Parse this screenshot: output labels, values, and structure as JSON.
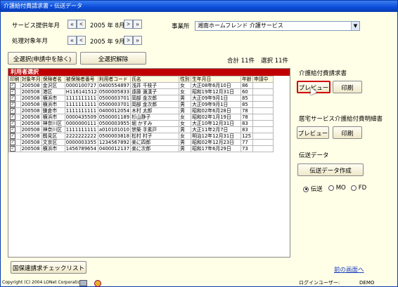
{
  "window": {
    "title": "介護給付費請求書・伝送データ"
  },
  "service_month": {
    "label": "サービス提供年月",
    "first": "«",
    "prev": "<",
    "value": "2005 年 8月",
    "next": ">",
    "last": "»"
  },
  "process_month": {
    "label": "処理対象年月",
    "first": "«",
    "prev": "<",
    "value": "2005 年 9月",
    "next": ">",
    "last": "»"
  },
  "office": {
    "label": "事業所",
    "value": "湘南ホームフレンド  介護サービス"
  },
  "select_all_label": "全選択(申請中を除く)",
  "deselect_all_label": "全選択解除",
  "totals": {
    "total": "合計 11件",
    "selected": "選択 11件"
  },
  "panel_title": "利用者選択",
  "table": {
    "headers": [
      "印刷",
      "対象年月",
      "保険者名",
      "被保険者番号",
      "利用者コード",
      "氏名",
      "性別",
      "生年月日",
      "年齢",
      "申請中"
    ],
    "rows": [
      [
        "",
        "200508",
        "金沢区",
        "0000100727",
        "0400554897",
        "浅井 千枝子",
        "女",
        "大正08年6月10日",
        "86",
        ""
      ],
      [
        "",
        "200508",
        "港区",
        "H116141512",
        "0500005833",
        "遠藤 蓮漢子",
        "女",
        "昭和19年12月31日",
        "60",
        ""
      ],
      [
        "",
        "200508",
        "横浜市",
        "1111111111",
        "0500003701",
        "岡部 金次郎",
        "男",
        "大正09年9月1日",
        "85",
        ""
      ],
      [
        "",
        "200508",
        "横浜市",
        "1111111111",
        "0500003701",
        "岡部 金次郎",
        "男",
        "大正09年9月1日",
        "85",
        ""
      ],
      [
        "",
        "200508",
        "鎌倉市",
        "1111111111",
        "0400012054",
        "木村 太郎",
        "男",
        "昭和02年6月28日",
        "78",
        ""
      ],
      [
        "",
        "200508",
        "横浜市",
        "0000435509",
        "0500001189",
        "杉山静子",
        "女",
        "昭和02年1月19日",
        "78",
        ""
      ],
      [
        "",
        "200508",
        "神奈川区",
        "0000000111",
        "0500003955",
        "堀 かすみ",
        "女",
        "大正10年12月31日",
        "83",
        ""
      ],
      [
        "",
        "200508",
        "神奈川区",
        "1111111111",
        "a010101010",
        "禁築 手素戸",
        "男",
        "大正11年2月7日",
        "83",
        ""
      ],
      [
        "",
        "200508",
        "鶴見区",
        "2222222222",
        "0500003818",
        "松村 村子",
        "女",
        "明治12年12月31日",
        "125",
        ""
      ],
      [
        "",
        "200508",
        "文京区",
        "0000003355",
        "1234567892",
        "楽に四郎",
        "男",
        "昭和02年12月23日",
        "77",
        ""
      ],
      [
        "",
        "200508",
        "横浜市",
        "1456789654",
        "0400012137",
        "楽に次郎",
        "男",
        "昭和17年6月29日",
        "73",
        ""
      ]
    ]
  },
  "kokuho_check_label": "国保連請求チェックリスト",
  "section_kaigo": {
    "title": "介護給付費請求書",
    "preview": "プレビュー",
    "print": "印刷"
  },
  "section_kyotaku": {
    "title": "居宅サービス介護給付費明細書",
    "preview": "プレビュー",
    "print": "印刷"
  },
  "section_denso": {
    "title": "伝送データ",
    "create": "伝送データ作成",
    "options": [
      {
        "label": "伝送",
        "selected": true
      },
      {
        "label": "MO",
        "selected": false
      },
      {
        "label": "FD",
        "selected": false
      }
    ]
  },
  "back_link": "前の画面へ",
  "status": {
    "copyright": "Copyright (C) 2004 LONet Corporation",
    "login_label": "ログインユーザー:",
    "login_user": "DEMO"
  },
  "colors": {
    "titlebar": "#0a4bd8",
    "panel_header": "#c00000",
    "background": "#ffffe8",
    "highlight": "#d00000",
    "link": "#2040c0"
  }
}
